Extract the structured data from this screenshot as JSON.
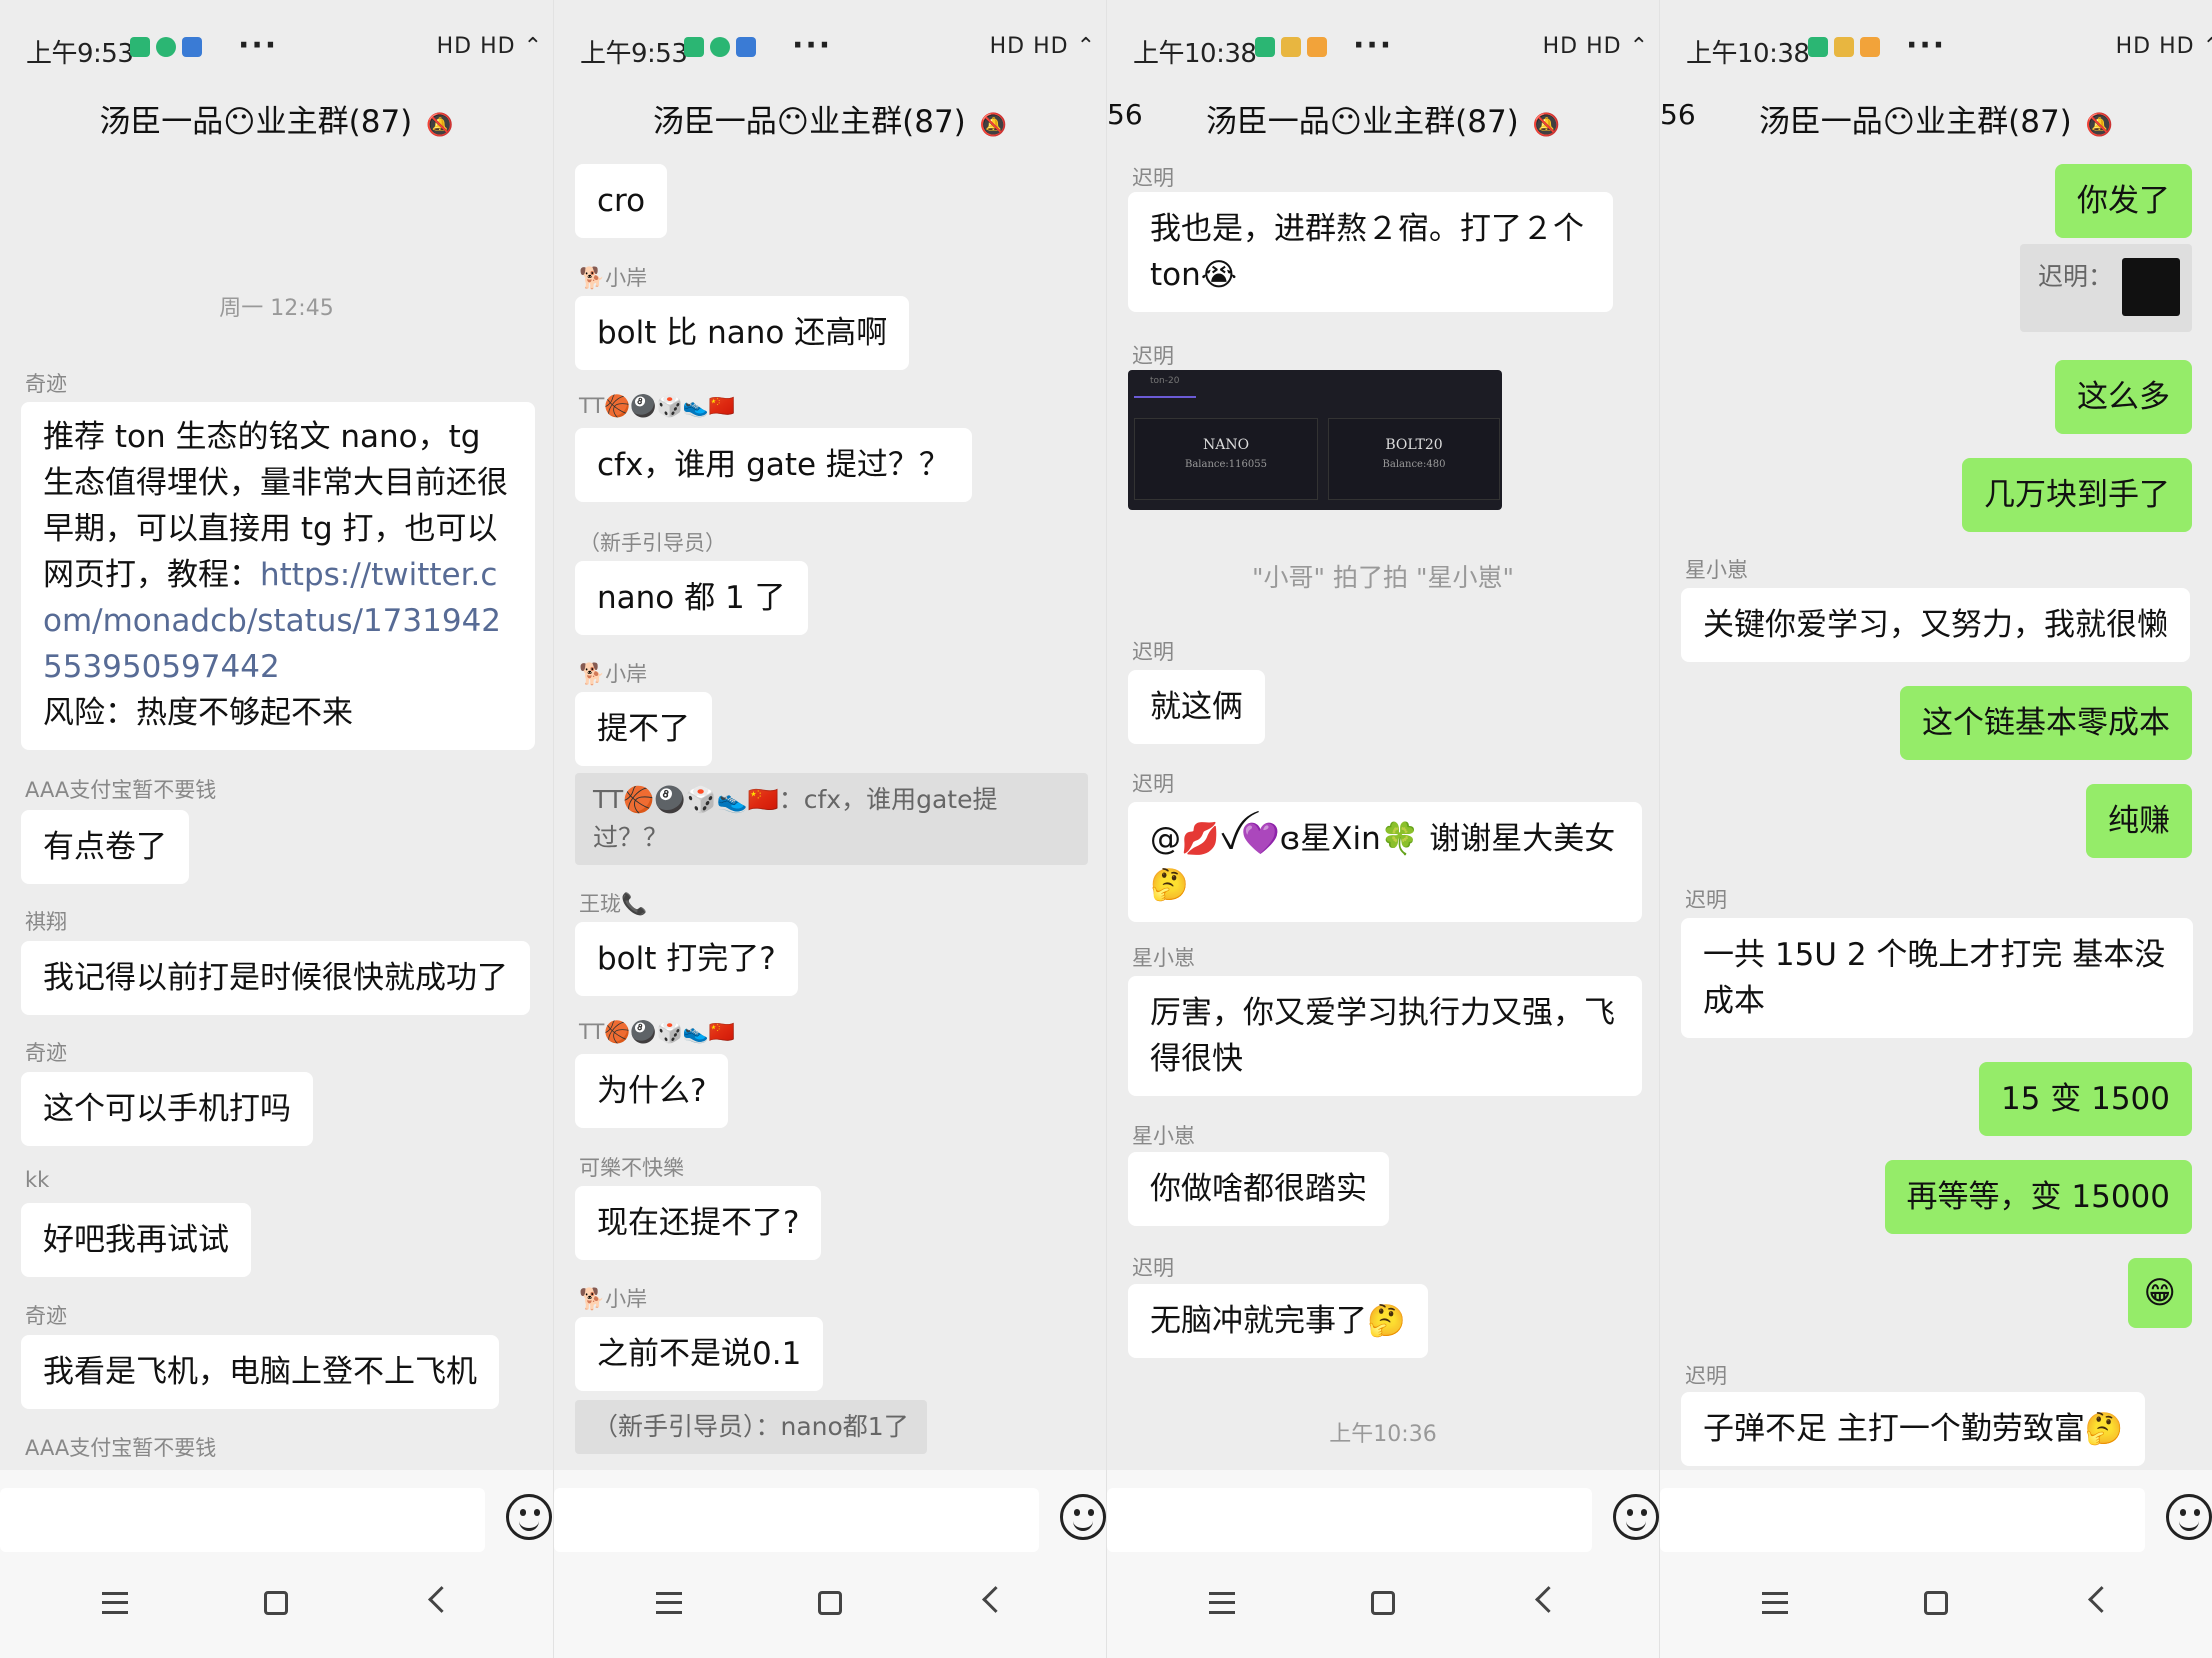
{
  "panels": [
    {
      "status_time": "上午9:53",
      "status_right": "HD HD ⌃",
      "title": "汤臣一品😶业主群(87)",
      "peek": "",
      "messages": [
        {
          "kind": "time",
          "text": "周一 12:45"
        },
        {
          "kind": "msg",
          "name": "奇迹",
          "text_a": "推荐 ton 生态的铭文 nano，tg 生态值得埋伏，量非常大目前还很早期，可以直接用 tg 打，也可以网页打，教程：",
          "link": "https://twitter.com/monadcb/status/1731942553950597442",
          "text_b": "风险：热度不够起不来"
        },
        {
          "kind": "msg",
          "name": "AAA支付宝暂不要钱",
          "text": "有点卷了"
        },
        {
          "kind": "msg",
          "name": "祺翔",
          "text": "我记得以前打是时候很快就成功了"
        },
        {
          "kind": "msg",
          "name": "奇迹",
          "text": "这个可以手机打吗"
        },
        {
          "kind": "msg",
          "name": "kk",
          "text": "好吧我再试试"
        },
        {
          "kind": "msg",
          "name": "奇迹",
          "text": "我看是飞机，电脑上登不上飞机"
        },
        {
          "kind": "msg",
          "name": "AAA支付宝暂不要钱",
          "text": ""
        }
      ]
    },
    {
      "status_time": "上午9:53",
      "status_right": "HD HD ⌃",
      "title": "汤臣一品😶业主群(87)",
      "peek": "",
      "messages": [
        {
          "kind": "msg",
          "name": "",
          "text": "cro"
        },
        {
          "kind": "msg",
          "name": "🐕小岸",
          "text": "bolt 比 nano 还高啊"
        },
        {
          "kind": "msg",
          "name": "TT🏀🎱🎲👟🇨🇳",
          "text": "cfx，谁用 gate 提过？？"
        },
        {
          "kind": "msg",
          "name": "（新手引导员）",
          "text": "nano 都 1 了"
        },
        {
          "kind": "msg",
          "name": "🐕小岸",
          "text": "提不了"
        },
        {
          "kind": "quote",
          "text": "TT🏀🎱🎲👟🇨🇳：cfx，谁用gate提过？？"
        },
        {
          "kind": "msg",
          "name": "王珑📞",
          "text": "bolt 打完了?"
        },
        {
          "kind": "msg",
          "name": "TT🏀🎱🎲👟🇨🇳",
          "text": "为什么?"
        },
        {
          "kind": "msg",
          "name": "可樂不快樂",
          "text": "现在还提不了?"
        },
        {
          "kind": "msg",
          "name": "🐕小岸",
          "text": "之前不是说0.1"
        },
        {
          "kind": "quote",
          "text": "（新手引导员）：nano都1了"
        }
      ]
    },
    {
      "status_time": "上午10:38",
      "status_right": "HD HD ⌃",
      "title": "汤臣一品😶业主群(87)",
      "peek": "56",
      "messages": [
        {
          "kind": "msg",
          "name": "迟明",
          "text": "我也是，进群熬２宿。打了２个ton😭"
        },
        {
          "kind": "image",
          "name": "迟明",
          "card_a_title": "NANO",
          "card_a_sub": "Balance:116055",
          "card_b_title": "BOLT20",
          "card_b_sub": "Balance:480",
          "tab": "ton-20"
        },
        {
          "kind": "sys",
          "text": "\"小哥\" 拍了拍 \"星小崽\""
        },
        {
          "kind": "msg",
          "name": "迟明",
          "text": "就这俩"
        },
        {
          "kind": "msg",
          "name": "迟明",
          "text": "@💋ꪜ💜ɞ星Xin🍀 谢谢星大美女🤔"
        },
        {
          "kind": "msg",
          "name": "星小崽",
          "text": "厉害，你又爱学习执行力又强，飞得很快"
        },
        {
          "kind": "msg",
          "name": "星小崽",
          "text": "你做啥都很踏实"
        },
        {
          "kind": "msg",
          "name": "迟明",
          "text": "无脑冲就完事了🤔"
        },
        {
          "kind": "time",
          "text": "上午10:36"
        }
      ]
    },
    {
      "status_time": "上午10:38",
      "status_right": "HD HD ⌃",
      "title": "汤臣一品😶业主群(87)",
      "peek": "56",
      "messages": [
        {
          "kind": "me",
          "text": "你发了"
        },
        {
          "kind": "quote",
          "text": "迟明："
        },
        {
          "kind": "me",
          "text": "这么多"
        },
        {
          "kind": "me",
          "text": "几万块到手了"
        },
        {
          "kind": "msg",
          "name": "星小崽",
          "text": "关键你爱学习，又努力，我就很懒"
        },
        {
          "kind": "me",
          "text": "这个链基本零成本"
        },
        {
          "kind": "me",
          "text": "纯赚"
        },
        {
          "kind": "msg",
          "name": "迟明",
          "text": "一共 15U  2 个晚上才打完 基本没成本"
        },
        {
          "kind": "me",
          "text": "15 变 1500"
        },
        {
          "kind": "me",
          "text": "再等等，变 15000"
        },
        {
          "kind": "me",
          "text": "😁"
        },
        {
          "kind": "msg",
          "name": "迟明",
          "text": "子弹不足 主打一个勤劳致富🤔"
        }
      ]
    }
  ],
  "icons": {
    "bell_muted": "bell-off-icon",
    "emoji": "smiley-icon",
    "menu": "menu-icon",
    "home": "home-icon",
    "back": "back-icon"
  },
  "colors": {
    "background": "#ededed",
    "bubble": "#ffffff",
    "my_bubble": "#95ec69",
    "link": "#576b95"
  }
}
